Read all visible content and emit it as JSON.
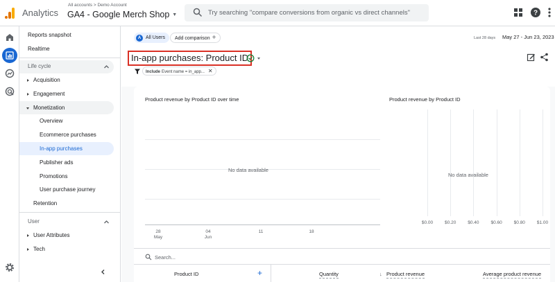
{
  "topbar": {
    "app_name": "Analytics",
    "breadcrumb": "All accounts > Demo Account",
    "property": "GA4 - Google Merch Shop",
    "search_placeholder": "Try searching \"compare conversions from organic vs direct channels\"",
    "icons": [
      "apps-grid-icon",
      "help-icon",
      "more-vert-icon"
    ]
  },
  "sidebar": {
    "reports_snapshot": "Reports snapshot",
    "realtime": "Realtime",
    "section_lifecycle": "Life cycle",
    "acquisition": "Acquisition",
    "engagement": "Engagement",
    "monetization": "Monetization",
    "overview": "Overview",
    "ecommerce": "Ecommerce purchases",
    "inapp": "In-app purchases",
    "publisher_ads": "Publisher ads",
    "promotions": "Promotions",
    "user_journey": "User purchase journey",
    "retention": "Retention",
    "section_user": "User",
    "user_attributes": "User Attributes",
    "tech": "Tech"
  },
  "main": {
    "comparison_chip": "All Users",
    "comparison_avatar": "A",
    "add_comparison": "Add comparison",
    "date_range_label": "Last 28 days",
    "date_range": "May 27 - Jun 23, 2023",
    "title": "In-app purchases: Product ID",
    "filter_include": "Include",
    "filter_value": "Event name = in_app...",
    "chart_left_title": "Product revenue by Product ID over time",
    "chart_right_title": "Product revenue by Product ID",
    "no_data": "No data available",
    "search_placeholder": "Search...",
    "table_headers": {
      "dimension": "Product ID",
      "quantity": "Quantity",
      "revenue": "Product revenue",
      "avg_revenue": "Average product revenue"
    }
  },
  "chart_data": [
    {
      "type": "line",
      "title": "Product revenue by Product ID over time",
      "x_ticks": [
        "28\nMay",
        "04\nJun",
        "11",
        "18"
      ],
      "series": [],
      "annotation": "No data available",
      "grid": true
    },
    {
      "type": "bar",
      "title": "Product revenue by Product ID",
      "x_ticks": [
        "$0.00",
        "$0.20",
        "$0.40",
        "$0.60",
        "$0.80",
        "$1.00"
      ],
      "categories": [],
      "values": [],
      "annotation": "No data available",
      "grid": true
    }
  ],
  "colors": {
    "accent": "#1967d2",
    "highlight": "#d93025",
    "active_nav_bg": "#e8f0fe",
    "expanded_nav_bg": "#f1f3f4"
  }
}
